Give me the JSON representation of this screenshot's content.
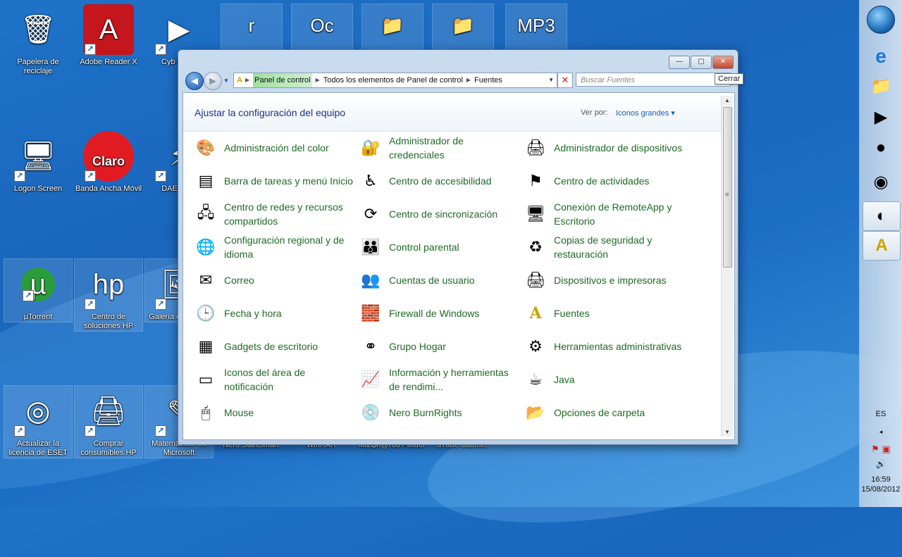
{
  "desktop": {
    "icons": [
      {
        "label": "Papelera de reciclaje",
        "glyph": "🗑",
        "shortcut": false
      },
      {
        "label": "Adobe Reader X",
        "glyph": "A",
        "shortcut": true
      },
      {
        "label": "Cyb Powe",
        "glyph": "▶",
        "shortcut": true
      },
      {
        "label": "Logon Screen",
        "glyph": "🖥",
        "shortcut": true
      },
      {
        "label": "Banda Ancha Móvil",
        "glyph": "Claro",
        "shortcut": true
      },
      {
        "label": "DAEMO L",
        "glyph": "⚡",
        "shortcut": true
      },
      {
        "label": "µTorrent",
        "glyph": "µ",
        "shortcut": true
      },
      {
        "label": "Centro de soluciones HP",
        "glyph": "hp",
        "shortcut": true
      },
      {
        "label": "Galería de Windo",
        "glyph": "🖼",
        "shortcut": true
      },
      {
        "label": "Actualizar la licencia de ESET",
        "glyph": "◎",
        "shortcut": true
      },
      {
        "label": "Comprar consumibles HP",
        "glyph": "🖨",
        "shortcut": true
      },
      {
        "label": "Matemáticas de Microsoft",
        "glyph": "✎",
        "shortcut": true
      },
      {
        "label": "Nero StartSmart",
        "glyph": "",
        "shortcut": false
      },
      {
        "label": "WinRAR",
        "glyph": "",
        "shortcut": false
      },
      {
        "label": "M&\\$h@r€d F©ld€r",
        "glyph": "",
        "shortcut": false
      },
      {
        "label": "aTube Catcher",
        "glyph": "",
        "shortcut": false
      }
    ],
    "top_partial_icons": [
      "r",
      "Oc",
      "📁",
      "📁",
      "MP3"
    ]
  },
  "window": {
    "tooltip": "Cerrar",
    "minimize": "—",
    "maximize": "▢",
    "close": "✕",
    "breadcrumbs": [
      "Panel de control",
      "Todos los elementos de Panel de control",
      "Fuentes"
    ],
    "search_placeholder": "Buscar Fuentes",
    "header_title": "Ajustar la configuración del equipo",
    "viewby_label": "Ver por:",
    "viewby_value": "Iconos grandes ▾",
    "items": [
      {
        "label": "Administración del color",
        "icon": "monitor-color-icon",
        "glyph": "🎨"
      },
      {
        "label": "Administrador de credenciales",
        "icon": "credentials-icon",
        "glyph": "🔐"
      },
      {
        "label": "Administrador de dispositivos",
        "icon": "device-manager-icon",
        "glyph": "🖨"
      },
      {
        "label": "Barra de tareas y menú Inicio",
        "icon": "taskbar-icon",
        "glyph": "▤"
      },
      {
        "label": "Centro de accesibilidad",
        "icon": "accessibility-icon",
        "glyph": "♿"
      },
      {
        "label": "Centro de actividades",
        "icon": "action-center-flag-icon",
        "glyph": "⚑"
      },
      {
        "label": "Centro de redes y recursos compartidos",
        "icon": "network-icon",
        "glyph": "🖧"
      },
      {
        "label": "Centro de sincronización",
        "icon": "sync-icon",
        "glyph": "⟳"
      },
      {
        "label": "Conexión de RemoteApp y Escritorio",
        "icon": "remoteapp-icon",
        "glyph": "🖥"
      },
      {
        "label": "Configuración regional y de idioma",
        "icon": "globe-icon",
        "glyph": "🌐"
      },
      {
        "label": "Control parental",
        "icon": "parental-control-icon",
        "glyph": "👪"
      },
      {
        "label": "Copias de seguridad y restauración",
        "icon": "backup-icon",
        "glyph": "♻"
      },
      {
        "label": "Correo",
        "icon": "mail-icon",
        "glyph": "✉"
      },
      {
        "label": "Cuentas de usuario",
        "icon": "user-accounts-icon",
        "glyph": "👥"
      },
      {
        "label": "Dispositivos e impresoras",
        "icon": "printer-icon",
        "glyph": "🖨"
      },
      {
        "label": "Fecha y hora",
        "icon": "calendar-clock-icon",
        "glyph": "🕒"
      },
      {
        "label": "Firewall de Windows",
        "icon": "firewall-icon",
        "glyph": "🧱"
      },
      {
        "label": "Fuentes",
        "icon": "fonts-folder-icon",
        "glyph": "A"
      },
      {
        "label": "Gadgets de escritorio",
        "icon": "gadgets-icon",
        "glyph": "▦"
      },
      {
        "label": "Grupo Hogar",
        "icon": "homegroup-icon",
        "glyph": "⚭"
      },
      {
        "label": "Herramientas administrativas",
        "icon": "admin-tools-icon",
        "glyph": "⚙"
      },
      {
        "label": "Iconos del área de notificación",
        "icon": "notification-area-icon",
        "glyph": "▭"
      },
      {
        "label": "Información y herramientas de rendimi...",
        "icon": "performance-icon",
        "glyph": "📈"
      },
      {
        "label": "Java",
        "icon": "java-icon",
        "glyph": "☕"
      },
      {
        "label": "Mouse",
        "icon": "mouse-icon",
        "glyph": "🖱"
      },
      {
        "label": "Nero BurnRights",
        "icon": "nero-icon",
        "glyph": "💿"
      },
      {
        "label": "Opciones de carpeta",
        "icon": "folder-options-icon",
        "glyph": "📂"
      }
    ]
  },
  "taskbar": {
    "buttons": [
      {
        "name": "ie-icon",
        "glyph": "e",
        "active": false
      },
      {
        "name": "explorer-icon",
        "glyph": "📁",
        "active": false
      },
      {
        "name": "media-icon",
        "glyph": "▶",
        "active": false
      },
      {
        "name": "app-icon-1",
        "glyph": "●",
        "active": false
      },
      {
        "name": "app-icon-2",
        "glyph": "◉",
        "active": false
      },
      {
        "name": "app-icon-3",
        "glyph": "◐",
        "active": true
      },
      {
        "name": "fonts-window-icon",
        "glyph": "A",
        "active": true
      }
    ],
    "lang": "ES",
    "time": "16:59",
    "date": "15/08/2012"
  },
  "colors": {
    "link_green": "#1e6a24",
    "title_blue": "#1e3287"
  }
}
